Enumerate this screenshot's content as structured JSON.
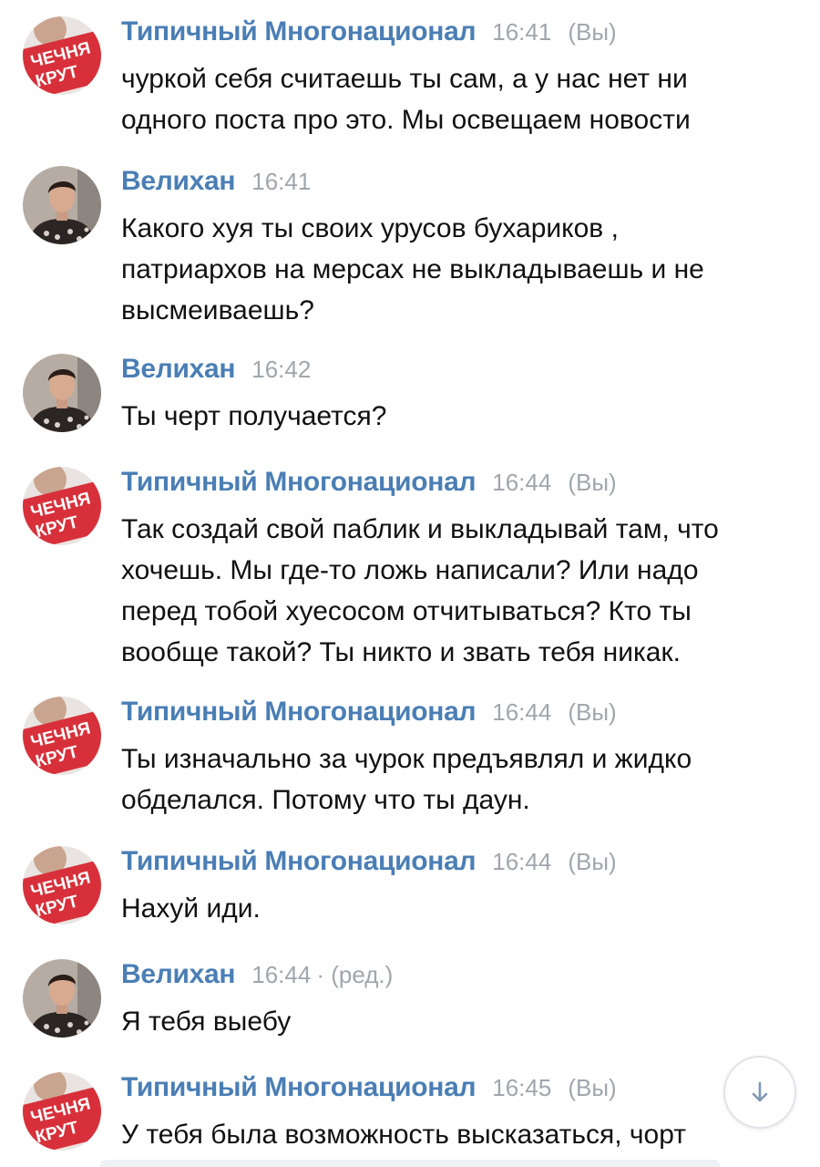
{
  "messages": [
    {
      "author": "Типичный Многонационал",
      "time": "16:41",
      "you": "(Вы)",
      "edited": "",
      "avatar": "group-logo",
      "lines": [
        "чуркой себя считаешь ты сам, а у нас нет ни",
        "одного поста про это. Мы освещаем новости"
      ]
    },
    {
      "author": "Велихан",
      "time": "16:41",
      "you": "",
      "edited": "",
      "avatar": "user-photo",
      "lines": [
        "Какого хуя ты своих урусов бухариков ,",
        "патриархов на мерсах не выкладываешь и не",
        "высмеиваешь?"
      ]
    },
    {
      "author": "Велихан",
      "time": "16:42",
      "you": "",
      "edited": "",
      "avatar": "user-photo",
      "lines": [
        "Ты черт получается?"
      ]
    },
    {
      "author": "Типичный Многонационал",
      "time": "16:44",
      "you": "(Вы)",
      "edited": "",
      "avatar": "group-logo",
      "lines": [
        "Так создай свой паблик и выкладывай там, что",
        "хочешь. Мы где-то ложь написали? Или надо",
        "перед тобой хуесосом отчитываться? Кто ты",
        "вообще такой? Ты никто и звать тебя никак."
      ]
    },
    {
      "author": "Типичный Многонационал",
      "time": "16:44",
      "you": "(Вы)",
      "edited": "",
      "avatar": "group-logo",
      "lines": [
        "Ты изначально за чурок предъявлял и жидко",
        "обделался. Потому что ты даун."
      ]
    },
    {
      "author": "Типичный Многонационал",
      "time": "16:44",
      "you": "(Вы)",
      "edited": "",
      "avatar": "group-logo",
      "lines": [
        "Нахуй иди."
      ]
    },
    {
      "author": "Велихан",
      "time": "16:44",
      "you": "",
      "edited": "· (ред.)",
      "avatar": "user-photo",
      "lines": [
        "Я тебя выебу"
      ]
    },
    {
      "author": "Типичный Многонационал",
      "time": "16:45",
      "you": "(Вы)",
      "edited": "",
      "avatar": "group-logo",
      "lines": [
        "У тебя была возможность высказаться, чорт"
      ]
    }
  ],
  "group_logo_text": [
    "ЧЕЧНЯ",
    "КРУТ"
  ],
  "scroll_button_icon": "arrow-down-icon",
  "colors": {
    "author": "#4a7eb5",
    "meta": "#a0a6ad",
    "text": "#111111",
    "logo_red": "#d8303a"
  }
}
